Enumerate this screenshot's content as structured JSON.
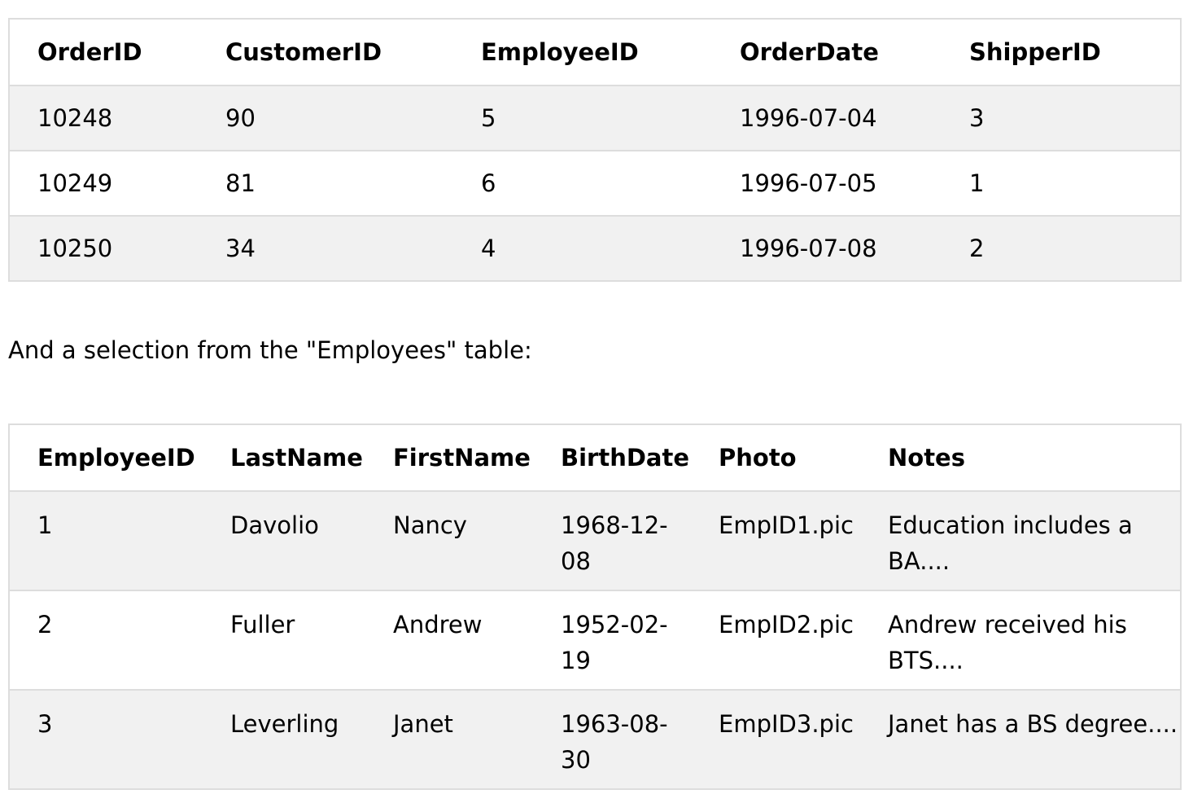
{
  "orders": {
    "headers": [
      "OrderID",
      "CustomerID",
      "EmployeeID",
      "OrderDate",
      "ShipperID"
    ],
    "rows": [
      [
        "10248",
        "90",
        "5",
        "1996-07-04",
        "3"
      ],
      [
        "10249",
        "81",
        "6",
        "1996-07-05",
        "1"
      ],
      [
        "10250",
        "34",
        "4",
        "1996-07-08",
        "2"
      ]
    ]
  },
  "intro_text": "And a selection from the \"Employees\" table:",
  "employees": {
    "headers": [
      "EmployeeID",
      "LastName",
      "FirstName",
      "BirthDate",
      "Photo",
      "Notes"
    ],
    "rows": [
      [
        "1",
        "Davolio",
        "Nancy",
        "1968-12-08",
        "EmpID1.pic",
        "Education includes a BA...."
      ],
      [
        "2",
        "Fuller",
        "Andrew",
        "1952-02-19",
        "EmpID2.pic",
        "Andrew received his BTS...."
      ],
      [
        "3",
        "Leverling",
        "Janet",
        "1963-08-30",
        "EmpID3.pic",
        "Janet has a BS degree...."
      ]
    ]
  }
}
